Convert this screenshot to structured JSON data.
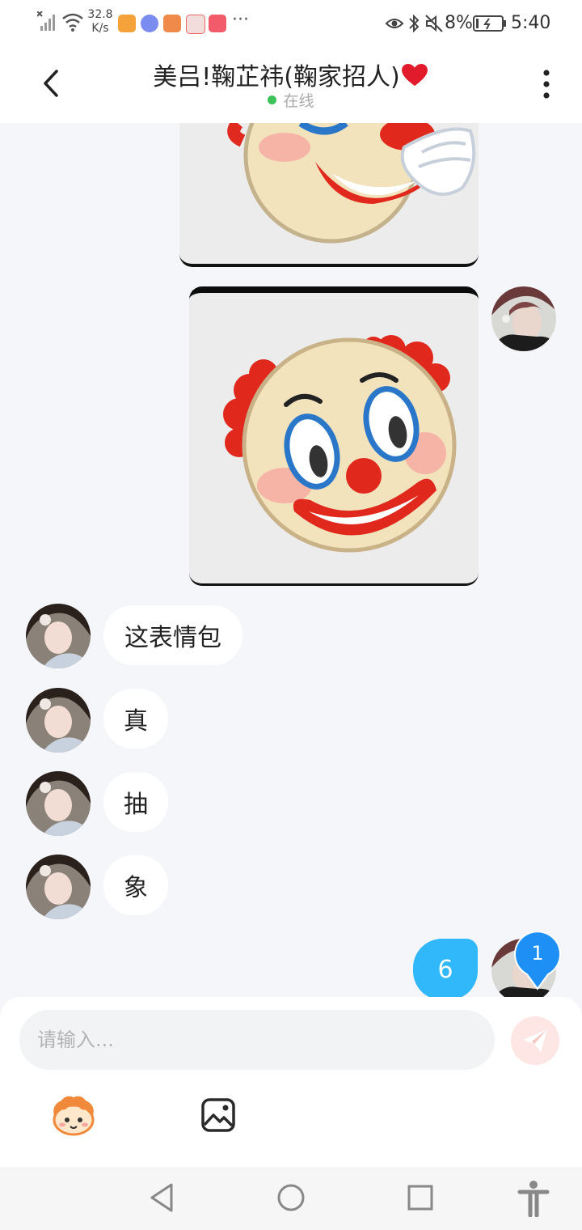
{
  "status_bar": {
    "net_speed_value": "32.8",
    "net_speed_unit": "K/s",
    "more": "···",
    "battery": "8%",
    "time": "5:40"
  },
  "header": {
    "title": "美吕!鞠芷祎(鞠家招人)",
    "status": "在线"
  },
  "messages": [
    {
      "side": "right",
      "type": "sticker",
      "sticker": "clown-face"
    },
    {
      "side": "right",
      "type": "sticker",
      "sticker": "clown-face"
    },
    {
      "side": "left",
      "type": "text",
      "text": "这表情包"
    },
    {
      "side": "left",
      "type": "text",
      "text": "真"
    },
    {
      "side": "left",
      "type": "text",
      "text": "抽"
    },
    {
      "side": "left",
      "type": "text",
      "text": "象"
    },
    {
      "side": "right",
      "type": "text",
      "text": "6"
    }
  ],
  "unread_badge": "1",
  "input": {
    "placeholder": "请输入..."
  },
  "toolbar": [
    "emoji-sticker-icon",
    "image-icon"
  ],
  "colors": {
    "online_dot": "#3bc35a",
    "my_bubble": "#31b8fb",
    "badge": "#1e90f5",
    "send_button": "#fde6e3"
  }
}
